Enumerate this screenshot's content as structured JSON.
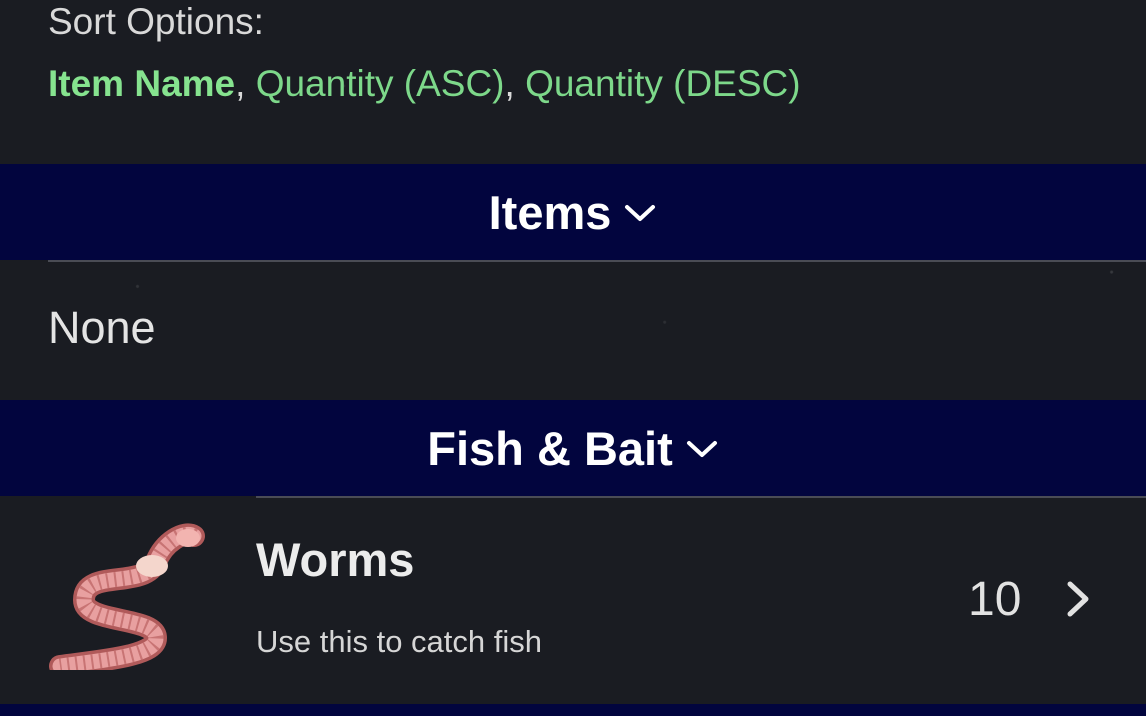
{
  "sort": {
    "title": "Sort Options:",
    "options": [
      "Item Name",
      "Quantity (ASC)",
      "Quantity (DESC)"
    ],
    "separator": ", ",
    "active_index": 0
  },
  "sections": [
    {
      "label": "Items",
      "empty_text": "None"
    },
    {
      "label": "Fish & Bait",
      "items": [
        {
          "name": "Worms",
          "description": "Use this to catch fish",
          "quantity": "10",
          "icon": "worm-icon"
        }
      ]
    }
  ],
  "colors": {
    "header_bg": "#02053e",
    "accent_green": "#86e38f",
    "page_bg": "#1a1c22"
  }
}
